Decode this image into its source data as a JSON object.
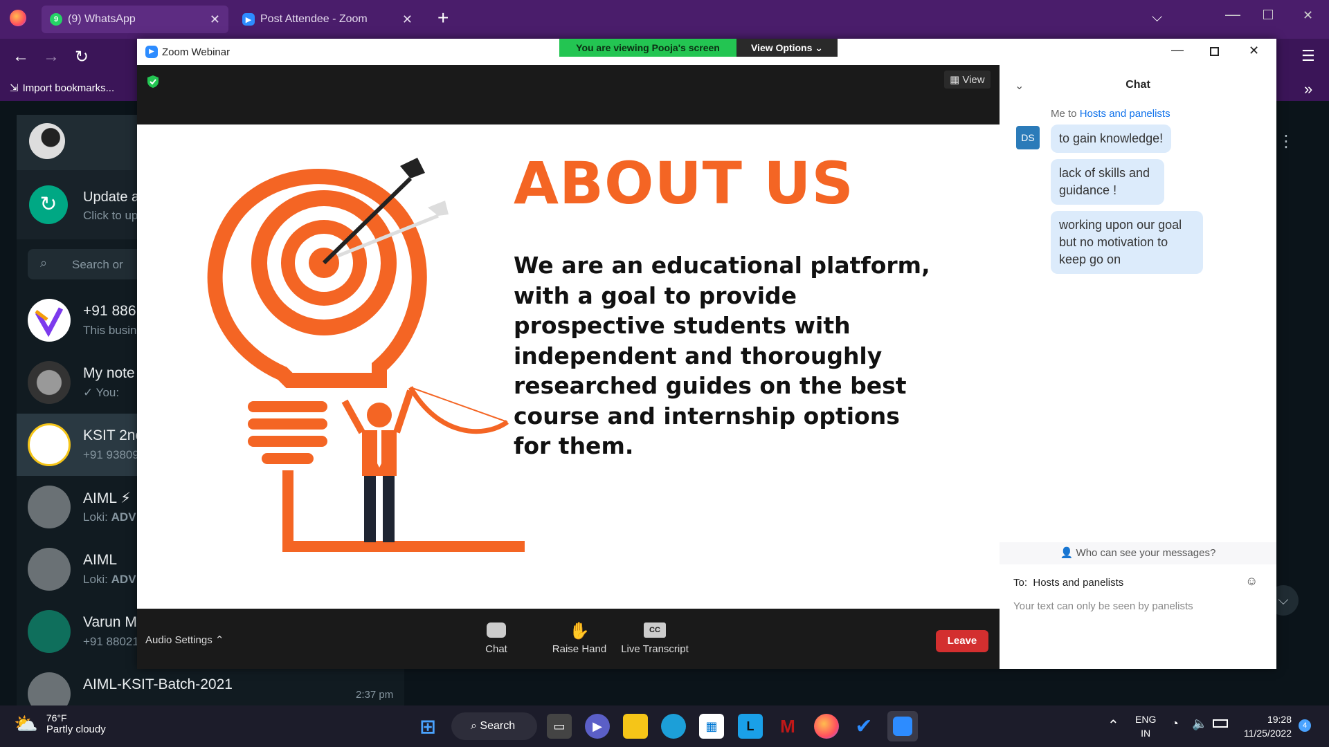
{
  "browser": {
    "tabs": [
      {
        "label": "(9) WhatsApp",
        "badge": "9"
      },
      {
        "label": "Post Attendee - Zoom"
      }
    ],
    "new_tab": "+",
    "bookmark": "Import bookmarks..."
  },
  "whatsapp": {
    "update_title": "Update a",
    "update_sub": "Click to up",
    "search_placeholder": "Search or",
    "chats": [
      {
        "name": "+91 886",
        "sub": "This busin"
      },
      {
        "name": "My note",
        "sub": "✓ You:"
      },
      {
        "name": "KSIT 2nc",
        "sub": "+91 93809"
      },
      {
        "name": "AIML ⚡",
        "sub_prefix": "Loki: ",
        "sub": "ADV"
      },
      {
        "name": "AIML",
        "sub_prefix": "Loki: ",
        "sub": "ADV"
      },
      {
        "name": "Varun M",
        "sub": "+91 88021"
      },
      {
        "name": "AIML-KSIT-Batch-2021",
        "time": "2:37 pm"
      }
    ]
  },
  "zoom": {
    "window_title": "Zoom Webinar",
    "banner_text": "You are viewing Pooja's screen",
    "view_options": "View Options",
    "view_button": "View",
    "slide": {
      "heading": "ABOUT US",
      "body_lines": [
        "We are an educational platform,",
        "with a goal to provide",
        "prospective students with",
        "independent and thoroughly",
        "researched guides on the best",
        "course and internship options",
        "for them."
      ]
    },
    "controls": {
      "audio_settings": "Audio Settings",
      "chat": "Chat",
      "raise_hand": "Raise Hand",
      "live_transcript": "Live Transcript",
      "cc": "CC",
      "leave": "Leave"
    },
    "chat_panel": {
      "title": "Chat",
      "sender_prefix": "Me to ",
      "recipients": "Hosts and panelists",
      "avatar_initials": "DS",
      "messages": [
        "to gain knowledge!",
        "lack of skills and guidance !",
        "working upon our goal but no motivation to keep go on"
      ],
      "visibility_prompt": "Who can see your messages?",
      "to_label": "To:",
      "to_value": "Hosts and panelists",
      "input_placeholder": "Your text can only be seen by panelists"
    }
  },
  "taskbar": {
    "temperature": "76°F",
    "weather": "Partly cloudy",
    "search": "Search",
    "language": "ENG",
    "region": "IN",
    "time": "19:28",
    "date": "11/25/2022",
    "notifications": "4"
  },
  "colors": {
    "accent_orange": "#f46524",
    "zoom_blue": "#2d8cff",
    "banner_green": "#23c552",
    "leave_red": "#d32f2f",
    "bubble_blue": "#dcebfb"
  }
}
